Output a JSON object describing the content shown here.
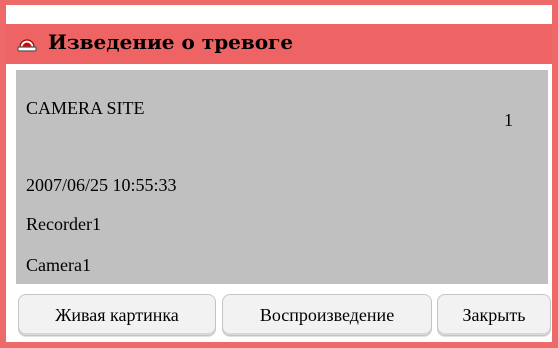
{
  "dialog": {
    "title": "Изведение о тревоге",
    "title_bar_color": "#ee6464",
    "title_icon": "alarm-siren-icon"
  },
  "info": {
    "site": "CAMERA SITE",
    "count": "1",
    "timestamp": "2007/06/25 10:55:33",
    "recorder": "Recorder1",
    "camera": "Camera1"
  },
  "buttons": {
    "live_label": "Живая картинка",
    "playback_label": "Воспроизведение",
    "close_label": "Закрыть"
  },
  "colors": {
    "accent_red": "#ee6464",
    "panel_grey": "#c0c0c0"
  }
}
